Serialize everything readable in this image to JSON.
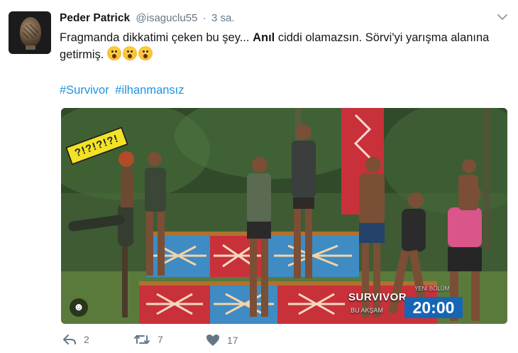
{
  "tweet": {
    "display_name": "Peder Patrick",
    "handle": "@isaguclu55",
    "separator": "·",
    "time": "3 sa.",
    "text_part1": "Fragmanda dikkatimi çeken bu şey... ",
    "text_bold": "Anıl",
    "text_part2": " ciddi olamazsın. Sörvi'yi yarışma alanına getirmiş.",
    "emoji_count": 3,
    "hashtags": [
      "#Survivor",
      "#ilhanmansız"
    ]
  },
  "media": {
    "sticker_text": "?!?!?!?!",
    "smile_icon": "☻",
    "brand_title": "SURVIVOR",
    "brand_subtitle": "BU AKŞAM",
    "episode_label": "YENİ BÖLÜM",
    "air_time": "20:00"
  },
  "actions": {
    "reply_count": "2",
    "retweet_count": "7",
    "like_count": "17"
  },
  "colors": {
    "link": "#1b95e0",
    "muted": "#657786",
    "text": "#14171a",
    "clock_bg": "#1666b5"
  }
}
